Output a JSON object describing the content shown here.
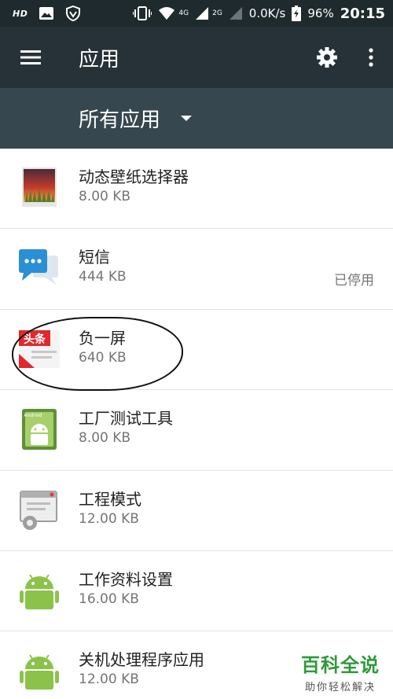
{
  "status_bar": {
    "left_label": "HD",
    "network": "4G",
    "network2": "2G",
    "speed": "0.0K/s",
    "battery": "96%",
    "time": "20:15"
  },
  "app_bar": {
    "title": "应用",
    "icons": [
      "menu-icon",
      "gear-icon",
      "more-vert-icon"
    ]
  },
  "filter": {
    "label": "所有应用",
    "icon": "dropdown-arrow-icon"
  },
  "apps": [
    {
      "name": "动态壁纸选择器",
      "size": "8.00 KB",
      "status": "",
      "icon": "live-wallpaper-icon"
    },
    {
      "name": "短信",
      "size": "444 KB",
      "status": "已停用",
      "icon": "messaging-icon"
    },
    {
      "name": "负一屏",
      "size": "640 KB",
      "status": "",
      "icon": "toutiao-icon",
      "icon_text": "头条"
    },
    {
      "name": "工厂测试工具",
      "size": "8.00 KB",
      "status": "",
      "icon": "android-app-icon",
      "icon_text": "Android"
    },
    {
      "name": "工程模式",
      "size": "12.00 KB",
      "status": "",
      "icon": "engineering-mode-icon"
    },
    {
      "name": "工作资料设置",
      "size": "16.00 KB",
      "status": "",
      "icon": "android-robot-icon"
    },
    {
      "name": "关机处理程序应用",
      "size": "12.00 KB",
      "status": "",
      "icon": "android-robot-icon"
    }
  ],
  "watermark": {
    "title": "百科全说",
    "subtitle": "助你轻松解决"
  },
  "colors": {
    "status_bar": "#1f2a2e",
    "app_bar": "#263238",
    "filter_bar": "#37474f",
    "primary_text": "#212121",
    "secondary_text": "#757575",
    "watermark_green": "#2e9a3a"
  }
}
